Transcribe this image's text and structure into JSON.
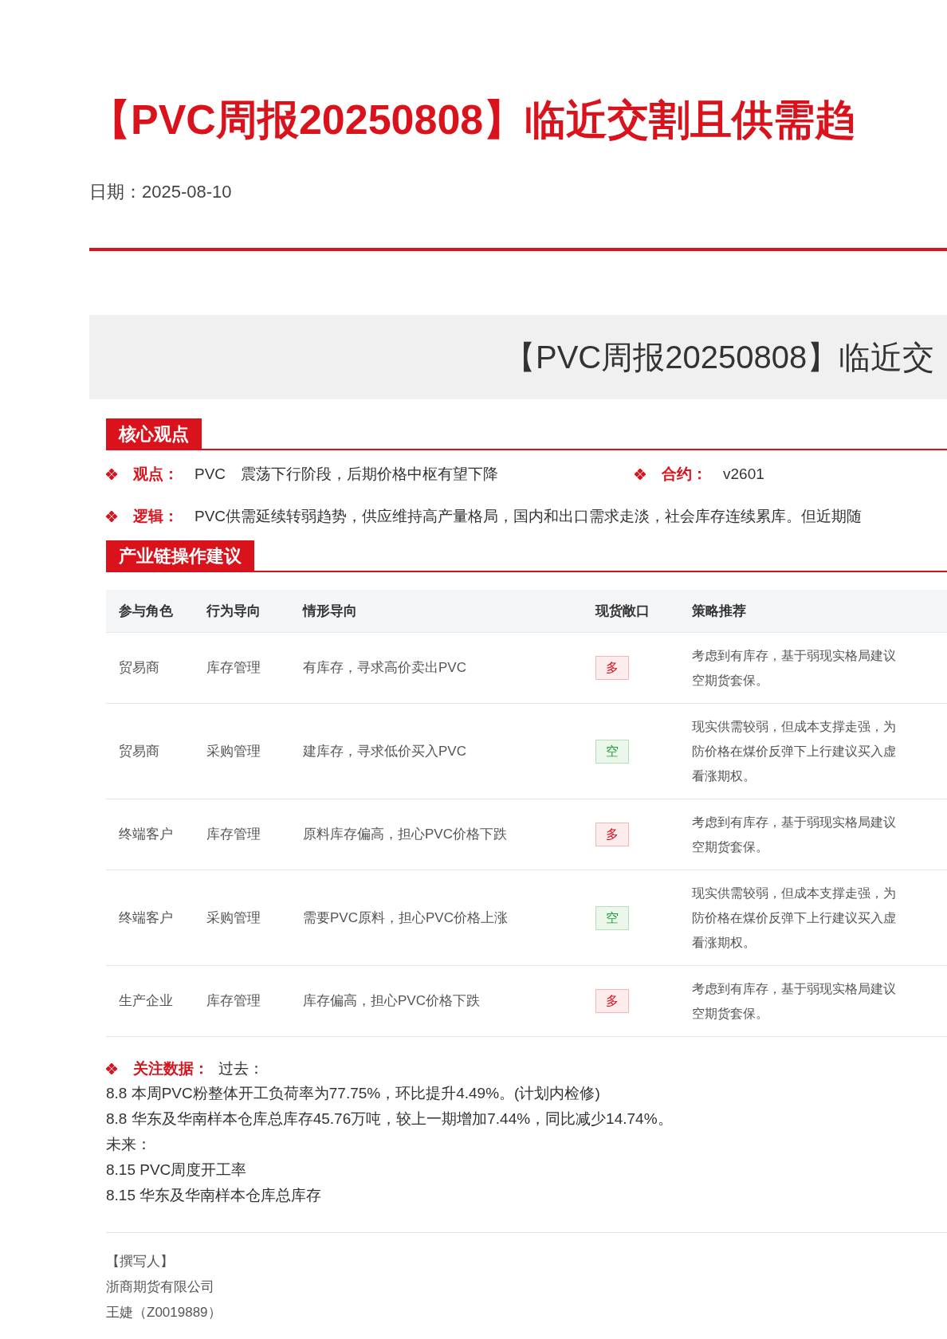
{
  "title": "【PVC周报20250808】临近交割且供需趋",
  "date": {
    "label": "日期：",
    "value": "2025-08-10"
  },
  "banner": "【PVC周报20250808】临近交",
  "sections": [
    {
      "heading": "核心观点"
    },
    {
      "heading": "产业链操作建议"
    }
  ],
  "core_view": {
    "view": {
      "label": "观点：",
      "value": "PVC　震荡下行阶段，后期价格中枢有望下降"
    },
    "contract": {
      "label": "合约：",
      "value": "v2601"
    },
    "logic": {
      "label": "逻辑：",
      "value": "PVC供需延续转弱趋势，供应维持高产量格局，国内和出口需求走淡，社会库存连续累库。但近期随"
    }
  },
  "table": {
    "columns": [
      "参与角色",
      "行为导向",
      "情形导向",
      "现货敞口",
      "策略推荐"
    ],
    "rows": [
      {
        "role": "贸易商",
        "action": "库存管理",
        "situation": "有库存，寻求高价卖出PVC",
        "exposure": {
          "label": "多",
          "kind": "long"
        },
        "strategy": [
          "考虑到有库存，基于弱现实格局建议",
          "空期货套保。"
        ]
      },
      {
        "role": "贸易商",
        "action": "采购管理",
        "situation": "建库存，寻求低价买入PVC",
        "exposure": {
          "label": "空",
          "kind": "short"
        },
        "strategy": [
          "现实供需较弱，但成本支撑走强，为",
          "防价格在煤价反弹下上行建议买入虚",
          "看涨期权。"
        ]
      },
      {
        "role": "终端客户",
        "action": "库存管理",
        "situation": "原料库存偏高，担心PVC价格下跌",
        "exposure": {
          "label": "多",
          "kind": "long"
        },
        "strategy": [
          "考虑到有库存，基于弱现实格局建议",
          "空期货套保。"
        ]
      },
      {
        "role": "终端客户",
        "action": "采购管理",
        "situation": "需要PVC原料，担心PVC价格上涨",
        "exposure": {
          "label": "空",
          "kind": "short"
        },
        "strategy": [
          "现实供需较弱，但成本支撑走强，为",
          "防价格在煤价反弹下上行建议买入虚",
          "看涨期权。"
        ]
      },
      {
        "role": "生产企业",
        "action": "库存管理",
        "situation": "库存偏高，担心PVC价格下跌",
        "exposure": {
          "label": "多",
          "kind": "long"
        },
        "strategy": [
          "考虑到有库存，基于弱现实格局建议",
          "空期货套保。"
        ]
      }
    ]
  },
  "watch_data": {
    "label": "关注数据：",
    "past_label": "过去：",
    "past": [
      "8.8 本周PVC粉整体开工负荷率为77.75%，环比提升4.49%。(计划内检修)",
      "8.8 华东及华南样本仓库总库存45.76万吨，较上一期增加7.44%，同比减少14.74%。"
    ],
    "future_label": "未来：",
    "future": [
      "8.15 PVC周度开工率",
      "8.15 华东及华南样本仓库总库存"
    ]
  },
  "author": [
    "【撰写人】",
    "浙商期货有限公司",
    "王婕（Z0019889）"
  ]
}
